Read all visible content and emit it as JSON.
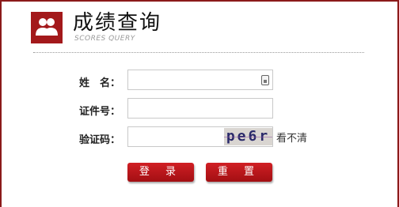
{
  "header": {
    "title": "成绩查询",
    "subtitle": "SCORES QUERY",
    "logo_icon": "users-icon"
  },
  "form": {
    "name_label": "姓　名：",
    "id_label": "证件号：",
    "captcha_label": "验证码：",
    "name_value": "",
    "id_value": "",
    "captcha_value": "",
    "captcha_text": "pe6r",
    "refresh_label": "看不清"
  },
  "buttons": {
    "login": "登 录",
    "reset": "重 置"
  },
  "colors": {
    "brand": "#a3191b",
    "border": "#8b1a1a"
  }
}
